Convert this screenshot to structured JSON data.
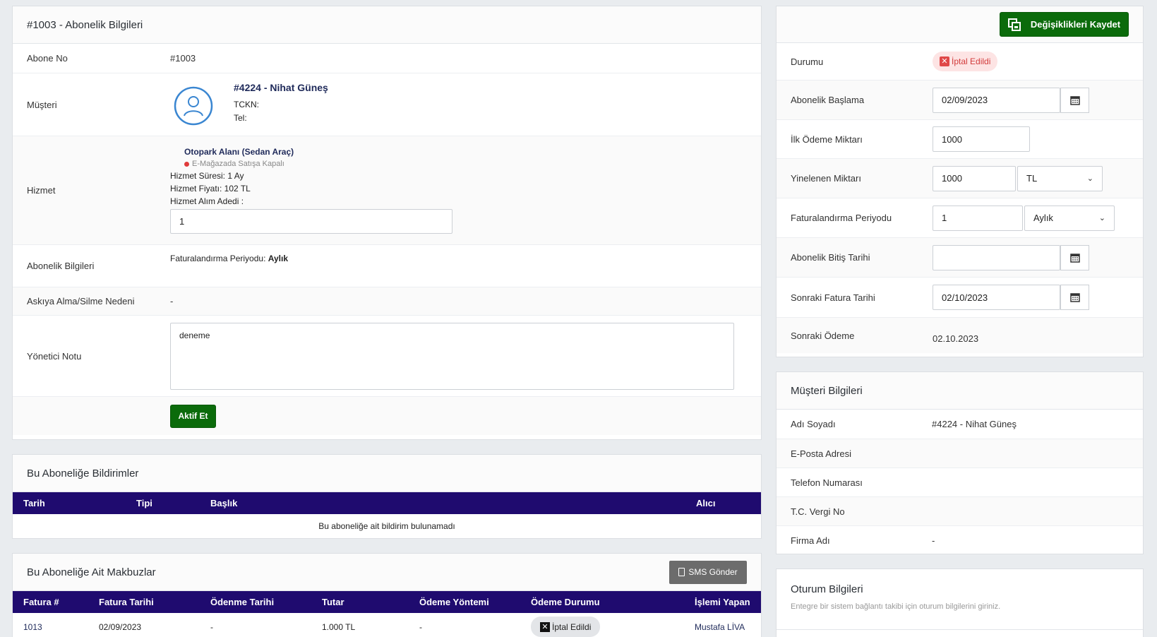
{
  "left": {
    "title": "#1003 - Abonelik Bilgileri",
    "abone_no_label": "Abone No",
    "abone_no": "#1003",
    "musteri_label": "Müşteri",
    "customer_name": "#4224 - Nihat Güneş",
    "tckn_label": "TCKN:",
    "tel_label": "Tel:",
    "hizmet_label": "Hizmet",
    "service_name": "Otopark Alanı (Sedan Araç)",
    "service_status": "E-Mağazada Satışa Kapalı",
    "service_duration": "Hizmet Süresi: 1 Ay",
    "service_price": "Hizmet Fiyatı: 102 TL",
    "service_qty_label": "Hizmet Alım Adedi :",
    "service_qty": "1",
    "abonelik_label": "Abonelik Bilgileri",
    "billing_period_prefix": "Faturalandırma Periyodu:",
    "billing_period_value": "Aylık",
    "askiya_label": "Askıya Alma/Silme Nedeni",
    "askiya_value": "-",
    "yonetici_label": "Yönetici Notu",
    "yonetici_note": "deneme",
    "activate_button": "Aktif Et"
  },
  "notifications": {
    "title": "Bu Aboneliğe Bildirimler",
    "columns": [
      "Tarih",
      "Tipi",
      "Başlık",
      "Alıcı"
    ],
    "empty": "Bu aboneliğe ait bildirim bulunamadı"
  },
  "receipts": {
    "title": "Bu Aboneliğe Ait Makbuzlar",
    "sms_button": "SMS Gönder",
    "columns": [
      "Fatura #",
      "Fatura Tarihi",
      "Ödenme Tarihi",
      "Tutar",
      "Ödeme Yöntemi",
      "Ödeme Durumu",
      "İşlemi Yapan"
    ],
    "rows": [
      {
        "fatura": "1013",
        "fatura_tarihi": "02/09/2023",
        "odenme": "-",
        "tutar": "1.000 TL",
        "yontem": "-",
        "durum": "İptal Edildi",
        "yapan": "Mustafa LİVA"
      }
    ]
  },
  "right": {
    "save_button": "Değişiklikleri Kaydet",
    "durum_label": "Durumu",
    "durum_value": "İptal Edildi",
    "baslama_label": "Abonelik Başlama",
    "baslama_value": "02/09/2023",
    "ilk_odeme_label": "İlk Ödeme Miktarı",
    "ilk_odeme_value": "1000",
    "yinelenen_label": "Yinelenen Miktarı",
    "yinelenen_value": "1000",
    "currency": "TL",
    "periyod_label": "Faturalandırma Periyodu",
    "periyod_value": "1",
    "periyod_unit": "Aylık",
    "bitis_label": "Abonelik Bitiş Tarihi",
    "bitis_value": "",
    "sonraki_fatura_label": "Sonraki Fatura Tarihi",
    "sonraki_fatura_value": "02/10/2023",
    "sonraki_odeme_label": "Sonraki Ödeme",
    "sonraki_odeme_value": "02.10.2023"
  },
  "customer": {
    "title": "Müşteri Bilgileri",
    "rows": [
      {
        "label": "Adı Soyadı",
        "value": "#4224 - Nihat Güneş"
      },
      {
        "label": "E-Posta Adresi",
        "value": ""
      },
      {
        "label": "Telefon Numarası",
        "value": ""
      },
      {
        "label": "T.C. Vergi No",
        "value": ""
      },
      {
        "label": "Firma Adı",
        "value": "-"
      }
    ]
  },
  "session": {
    "title": "Oturum Bilgileri",
    "subtitle": "Entegre bir sistem bağlantı takibi için oturum bilgilerini giriniz."
  },
  "colors": {
    "accent_green": "#0b6b0b",
    "table_header": "#1f0b6f",
    "status_red": "#e03b3b"
  }
}
